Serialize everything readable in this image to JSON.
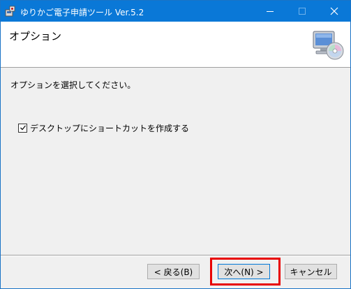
{
  "window": {
    "title": "ゆりかご電子申請ツール Ver.5.2",
    "icons": {
      "app": "installer-icon",
      "minimize": "minimize-icon",
      "maximize": "maximize-icon",
      "close": "close-icon"
    }
  },
  "header": {
    "title": "オプション",
    "icon": "computer-cd-setup-icon"
  },
  "body": {
    "instruction": "オプションを選択してください。",
    "checkbox": {
      "label": "デスクトップにショートカットを作成する",
      "checked": true
    }
  },
  "buttons": {
    "back": "< 戻る(B)",
    "next": "次へ(N) >",
    "cancel": "キャンセル"
  },
  "colors": {
    "titlebar": "#0a78d7",
    "highlight": "#e80000",
    "default_button_border": "#0078d7"
  }
}
